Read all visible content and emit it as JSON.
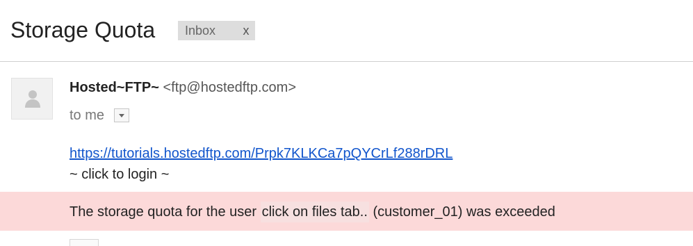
{
  "header": {
    "subject": "Storage Quota",
    "label": "Inbox",
    "label_close": "x"
  },
  "message": {
    "sender_name": "Hosted~FTP~",
    "sender_email": "<ftp@hostedftp.com>",
    "recipient": "to me",
    "avatar_icon": "person-icon",
    "toggle_icon": "chevron-down-icon",
    "body": {
      "link": "https://tutorials.hostedftp.com/Prpk7KLKCa7pQYCrLf288rDRL",
      "login_note": "~ click to login ~",
      "alert_before": "The storage quota for the user ",
      "alert_highlight": "click on files tab..",
      "alert_after": " (customer_01) was exceeded"
    }
  },
  "colors": {
    "link": "#1155cc",
    "alert_background": "#fcd9d9",
    "label_chip": "#dddddd"
  }
}
